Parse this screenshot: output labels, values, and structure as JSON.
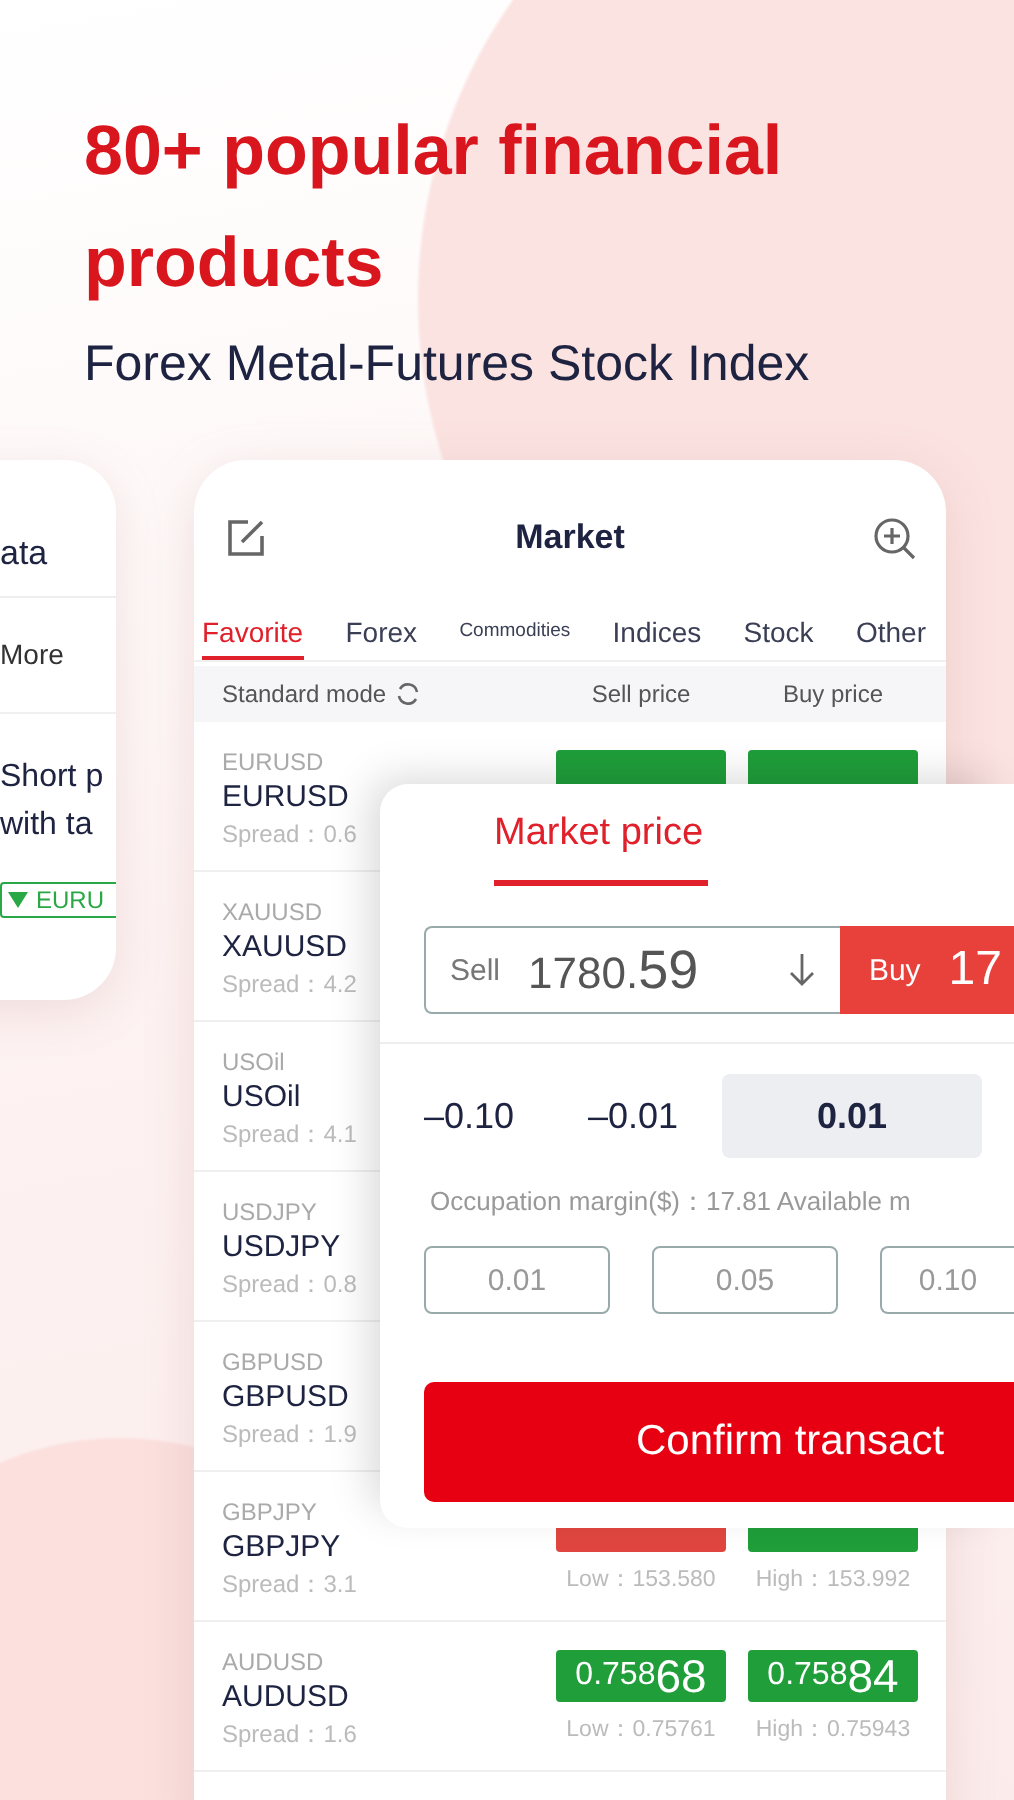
{
  "headline": "80+ popular financial products",
  "subtitle": "Forex Metal-Futures Stock Index",
  "side_card": {
    "title": "ata",
    "link": "More",
    "lines": [
      "Short p",
      "with ta"
    ],
    "tag": "EURU"
  },
  "market": {
    "title": "Market",
    "tabs": [
      {
        "label": "Favorite",
        "selected": true,
        "kind": "normal"
      },
      {
        "label": "Forex",
        "selected": false,
        "kind": "normal"
      },
      {
        "label": "Commodities",
        "selected": false,
        "kind": "compact"
      },
      {
        "label": "Indices",
        "selected": false,
        "kind": "normal"
      },
      {
        "label": "Stock",
        "selected": false,
        "kind": "normal"
      },
      {
        "label": "Other",
        "selected": false,
        "kind": "normal"
      }
    ],
    "columns": {
      "mode": "Standard mode",
      "sell": "Sell price",
      "buy": "Buy price"
    },
    "rows": [
      {
        "symbol": "EURUSD",
        "name": "EURUSD",
        "spread": "Spread：0.6",
        "sell": {
          "color": "#1f9e3a"
        },
        "buy": {
          "color": "#1f9e3a"
        }
      },
      {
        "symbol": "XAUUSD",
        "name": "XAUUSD",
        "spread": "Spread：4.2"
      },
      {
        "symbol": "USOil",
        "name": "USOil",
        "spread": "Spread：4.1"
      },
      {
        "symbol": "USDJPY",
        "name": "USDJPY",
        "spread": "Spread：0.8"
      },
      {
        "symbol": "GBPUSD",
        "name": "GBPUSD",
        "spread": "Spread：1.9"
      },
      {
        "symbol": "GBPJPY",
        "name": "GBPJPY",
        "spread": "Spread：3.1",
        "sell": {
          "color": "#e0463f",
          "note": "Low：153.580"
        },
        "buy": {
          "color": "#1f9e3a",
          "note": "High：153.992"
        }
      },
      {
        "symbol": "AUDUSD",
        "name": "AUDUSD",
        "spread": "Spread：1.6",
        "sell": {
          "color": "#1f9e3a",
          "price": "0.75868",
          "note": "Low：0.75761"
        },
        "buy": {
          "color": "#1f9e3a",
          "price": "0.75884",
          "note": "High：0.75943"
        }
      }
    ]
  },
  "order": {
    "tab": {
      "label": "Market price",
      "selected": true
    },
    "sell": {
      "label": "Sell",
      "price": "1780.59"
    },
    "buy": {
      "label": "Buy",
      "price": "17"
    },
    "steps": [
      {
        "label": "–0.10",
        "selected": false
      },
      {
        "label": "–0.01",
        "selected": false
      },
      {
        "label": "0.01",
        "selected": true
      }
    ],
    "margin": "Occupation margin($)：17.81  Available m",
    "lots": [
      "0.01",
      "0.05",
      "0.10"
    ],
    "confirm": "Confirm transact"
  }
}
